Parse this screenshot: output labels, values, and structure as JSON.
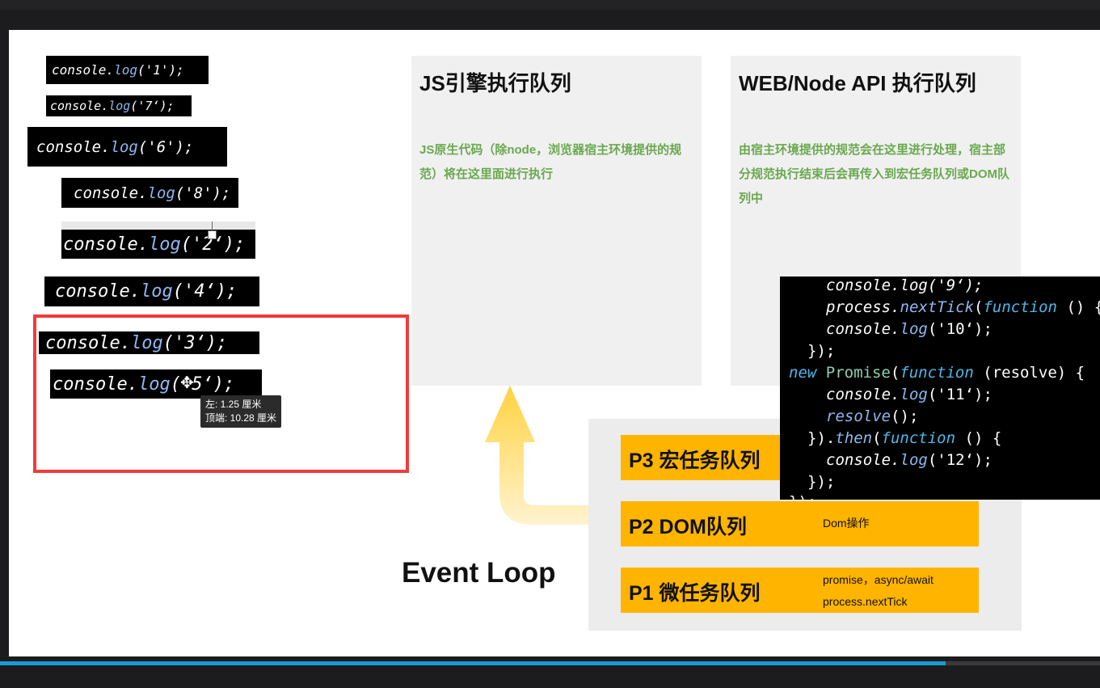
{
  "code_snippets": [
    {
      "fn": "console.",
      "method": "log",
      "arg": "('1');"
    },
    {
      "fn": "console.",
      "method": "log",
      "arg": "('7‘);"
    },
    {
      "fn": "console.",
      "method": "log",
      "arg": "('6');"
    },
    {
      "fn": "console.",
      "method": "log",
      "arg": "('8');"
    },
    {
      "fn": "console.",
      "method": "log",
      "arg": "('2‘);"
    },
    {
      "fn": "console.",
      "method": "log",
      "arg": "('4‘);"
    },
    {
      "fn": "console.",
      "method": "log",
      "arg": "('3‘);"
    },
    {
      "fn": "console.",
      "method": "log",
      "arg": "('5‘);"
    }
  ],
  "tooltip": {
    "left": "左: 1.25 厘米",
    "top": "顶端: 10.28 厘米"
  },
  "js_panel": {
    "title": "JS引擎执行队列",
    "desc": "JS原生代码（除node，浏览器宿主环境提供的规范）将在这里面进行执行"
  },
  "web_panel": {
    "title": "WEB/Node API 执行队列",
    "desc": "由宿主环境提供的规范会在这里进行处理，宿主部分规范执行结束后会再传入到宏任务队列或DOM队列中"
  },
  "event_loop_label": "Event Loop",
  "queues": {
    "p3": {
      "label": "P3 宏任务队列"
    },
    "p2": {
      "label": "P2 DOM队列",
      "note": "Dom操作"
    },
    "p1": {
      "label": "P1 微任务队列",
      "note1": "promise，async/await",
      "note2": "process.nextTick"
    }
  },
  "big_code": {
    "l1": "console.log('9‘);",
    "l2a": "process.",
    "l2b": "nextTick",
    "l2c": "(",
    "l2d": "function",
    "l2e": " () {",
    "l3a": "console.",
    "l3b": "log",
    "l3c": "('10‘);",
    "l4": "});",
    "l5a": "new",
    "l5b": " Promise",
    "l5c": "(",
    "l5d": "function",
    "l5e": " (resolve) {",
    "l6a": "console.",
    "l6b": "log",
    "l6c": "('11‘);",
    "l7a": "resolve",
    "l7b": "();",
    "l8a": "}).",
    "l8b": "then",
    "l8c": "(",
    "l8d": "function",
    "l8e": " () {",
    "l9a": "console.",
    "l9b": "log",
    "l9c": "('12‘);",
    "l10": "});",
    "l11": "});"
  },
  "progress": 0.86,
  "colors": {
    "queue": "#ffb400",
    "highlight_border": "#ef3b3b",
    "panel_bg": "#f0f0f0",
    "green_text": "#6aa84f",
    "progress": "#1b9ad6"
  }
}
